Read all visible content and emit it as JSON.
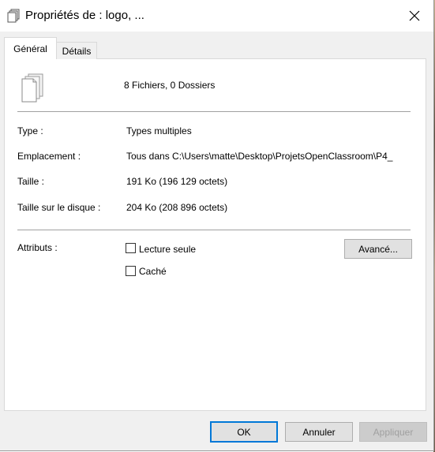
{
  "window": {
    "title": "Propriétés de : logo, ..."
  },
  "tabs": [
    {
      "label": "Général"
    },
    {
      "label": "Détails"
    }
  ],
  "general": {
    "summary": "8 Fichiers, 0 Dossiers",
    "type_label": "Type :",
    "type_value": "Types multiples",
    "location_label": "Emplacement :",
    "location_value": "Tous dans C:\\Users\\matte\\Desktop\\ProjetsOpenClassroom\\P4_",
    "size_label": "Taille :",
    "size_value": "191 Ko (196 129 octets)",
    "disk_size_label": "Taille sur le disque :",
    "disk_size_value": "204 Ko (208 896 octets)",
    "attributes_label": "Attributs :",
    "readonly_label": "Lecture seule",
    "hidden_label": "Caché",
    "advanced_label": "Avancé..."
  },
  "buttons": {
    "ok": "OK",
    "cancel": "Annuler",
    "apply": "Appliquer"
  },
  "icons": {
    "title": "multiple-files-icon",
    "file": "multiple-files-icon",
    "close": "close-icon"
  }
}
